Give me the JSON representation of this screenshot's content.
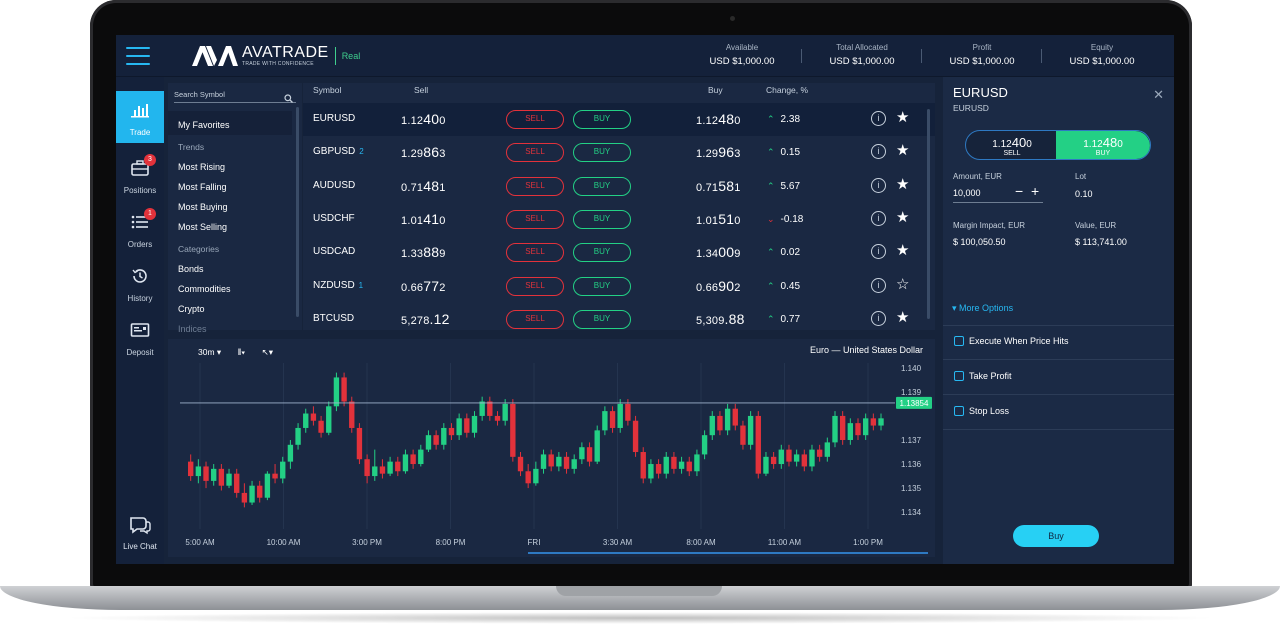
{
  "brand": {
    "name": "AVATRADE",
    "tagline": "TRADE WITH CONFIDENCE",
    "account_type": "Real"
  },
  "header_stats": [
    {
      "label": "Available",
      "value": "USD $1,000.00"
    },
    {
      "label": "Total Allocated",
      "value": "USD $1,000.00"
    },
    {
      "label": "Profit",
      "value": "USD $1,000.00"
    },
    {
      "label": "Equity",
      "value": "USD $1,000.00"
    }
  ],
  "nav": {
    "items": [
      {
        "label": "Trade",
        "icon": "bar-chart-icon",
        "active": true
      },
      {
        "label": "Positions",
        "icon": "briefcase-icon",
        "badge": "3"
      },
      {
        "label": "Orders",
        "icon": "list-icon",
        "badge": "1"
      },
      {
        "label": "History",
        "icon": "history-icon"
      },
      {
        "label": "Deposit",
        "icon": "deposit-icon"
      }
    ],
    "live_chat": "Live Chat"
  },
  "symbols_panel": {
    "search_placeholder": "Search Symbol",
    "favorites": "My Favorites",
    "trends_header": "Trends",
    "trends": [
      "Most Rising",
      "Most Falling",
      "Most Buying",
      "Most Selling"
    ],
    "categories_header": "Categories",
    "categories": [
      "Bonds",
      "Commodities",
      "Crypto",
      "Indices"
    ]
  },
  "quotes": {
    "headers": {
      "symbol": "Symbol",
      "sell": "Sell",
      "buy": "Buy",
      "change": "Change, %"
    },
    "sell_label": "SELL",
    "buy_label": "BUY",
    "rows": [
      {
        "symbol": "EURUSD",
        "count": "",
        "sell_a": "1.12",
        "sell_b": "40",
        "sell_c": "0",
        "buy_a": "1.12",
        "buy_b": "48",
        "buy_c": "0",
        "change": "2.38",
        "dir": "up",
        "fav": true
      },
      {
        "symbol": "GBPUSD",
        "count": "2",
        "sell_a": "1.29",
        "sell_b": "86",
        "sell_c": "3",
        "buy_a": "1.29",
        "buy_b": "96",
        "buy_c": "3",
        "change": "0.15",
        "dir": "up",
        "fav": true
      },
      {
        "symbol": "AUDUSD",
        "count": "",
        "sell_a": "0.71",
        "sell_b": "48",
        "sell_c": "1",
        "buy_a": "0.71",
        "buy_b": "58",
        "buy_c": "1",
        "change": "5.67",
        "dir": "up",
        "fav": true
      },
      {
        "symbol": "USDCHF",
        "count": "",
        "sell_a": "1.01",
        "sell_b": "41",
        "sell_c": "0",
        "buy_a": "1.01",
        "buy_b": "51",
        "buy_c": "0",
        "change": "-0.18",
        "dir": "down",
        "fav": true
      },
      {
        "symbol": "USDCAD",
        "count": "",
        "sell_a": "1.33",
        "sell_b": "88",
        "sell_c": "9",
        "buy_a": "1.34",
        "buy_b": "00",
        "buy_c": "9",
        "change": "0.02",
        "dir": "up",
        "fav": true
      },
      {
        "symbol": "NZDUSD",
        "count": "1",
        "sell_a": "0.66",
        "sell_b": "77",
        "sell_c": "2",
        "buy_a": "0.66",
        "buy_b": "90",
        "buy_c": "2",
        "change": "0.45",
        "dir": "up",
        "fav": false
      },
      {
        "symbol": "BTCUSD",
        "count": "",
        "sell_a": "5,278",
        "sell_b": ".12",
        "sell_c": "",
        "buy_a": "5,309",
        "buy_b": ".88",
        "buy_c": "",
        "change": "0.77",
        "dir": "up",
        "fav": true
      }
    ]
  },
  "chart": {
    "timeframe": "30m",
    "title": "Euro — United States Dollar",
    "y_ticks": [
      "1.140",
      "1.139",
      "1.137",
      "1.136",
      "1.135",
      "1.134"
    ],
    "current_price": "1.13854",
    "x_ticks": [
      "5:00 AM",
      "10:00 AM",
      "3:00 PM",
      "8:00 PM",
      "FRI",
      "3:30 AM",
      "8:00 AM",
      "11:00 AM",
      "1:00 PM"
    ]
  },
  "chart_data": {
    "type": "candlestick",
    "title": "Euro — United States Dollar",
    "interval": "30m",
    "ylim": [
      1.1333,
      1.1402
    ],
    "current_price": 1.13854,
    "x_ticks": [
      "5:00 AM",
      "10:00 AM",
      "3:00 PM",
      "8:00 PM",
      "FRI",
      "3:30 AM",
      "8:00 AM",
      "11:00 AM",
      "1:00 PM"
    ],
    "y_ticks": [
      1.14,
      1.139,
      1.137,
      1.136,
      1.135,
      1.134
    ],
    "candles": [
      [
        1.1361,
        1.1355,
        1.1364,
        1.1353
      ],
      [
        1.1355,
        1.1359,
        1.1362,
        1.1352
      ],
      [
        1.1359,
        1.1353,
        1.1361,
        1.135
      ],
      [
        1.1353,
        1.1358,
        1.136,
        1.1351
      ],
      [
        1.1358,
        1.1351,
        1.136,
        1.1349
      ],
      [
        1.1351,
        1.1356,
        1.1358,
        1.135
      ],
      [
        1.1356,
        1.1348,
        1.1358,
        1.1346
      ],
      [
        1.1348,
        1.1344,
        1.1352,
        1.1342
      ],
      [
        1.1344,
        1.1351,
        1.1353,
        1.1343
      ],
      [
        1.1351,
        1.1346,
        1.1353,
        1.1344
      ],
      [
        1.1346,
        1.1356,
        1.1357,
        1.1345
      ],
      [
        1.1356,
        1.1354,
        1.136,
        1.1352
      ],
      [
        1.1354,
        1.1361,
        1.1363,
        1.1352
      ],
      [
        1.1361,
        1.1368,
        1.137,
        1.1358
      ],
      [
        1.1368,
        1.1375,
        1.1377,
        1.1366
      ],
      [
        1.1375,
        1.1381,
        1.1383,
        1.1373
      ],
      [
        1.1381,
        1.1378,
        1.1384,
        1.1376
      ],
      [
        1.1378,
        1.1373,
        1.138,
        1.1371
      ],
      [
        1.1373,
        1.1384,
        1.1386,
        1.1372
      ],
      [
        1.1384,
        1.1396,
        1.1398,
        1.1382
      ],
      [
        1.1396,
        1.1386,
        1.1398,
        1.1384
      ],
      [
        1.1386,
        1.1375,
        1.1388,
        1.1373
      ],
      [
        1.1375,
        1.1362,
        1.1377,
        1.136
      ],
      [
        1.1362,
        1.1355,
        1.1364,
        1.1352
      ],
      [
        1.1355,
        1.1359,
        1.1366,
        1.1353
      ],
      [
        1.1359,
        1.1356,
        1.1362,
        1.1354
      ],
      [
        1.1356,
        1.1361,
        1.1363,
        1.1355
      ],
      [
        1.1361,
        1.1357,
        1.1363,
        1.1355
      ],
      [
        1.1357,
        1.1364,
        1.1366,
        1.1356
      ],
      [
        1.1364,
        1.136,
        1.1366,
        1.1358
      ],
      [
        1.136,
        1.1366,
        1.1368,
        1.1359
      ],
      [
        1.1366,
        1.1372,
        1.1374,
        1.1365
      ],
      [
        1.1372,
        1.1368,
        1.1374,
        1.1366
      ],
      [
        1.1368,
        1.1375,
        1.1377,
        1.1366
      ],
      [
        1.1375,
        1.1372,
        1.1377,
        1.137
      ],
      [
        1.1372,
        1.1379,
        1.1381,
        1.137
      ],
      [
        1.1379,
        1.1373,
        1.1381,
        1.1371
      ],
      [
        1.1373,
        1.138,
        1.1382,
        1.1371
      ],
      [
        1.138,
        1.1386,
        1.1388,
        1.1378
      ],
      [
        1.1386,
        1.138,
        1.1388,
        1.1378
      ],
      [
        1.138,
        1.1378,
        1.1382,
        1.1376
      ],
      [
        1.1378,
        1.1385,
        1.1387,
        1.1376
      ],
      [
        1.1385,
        1.1363,
        1.1387,
        1.1361
      ],
      [
        1.1363,
        1.1357,
        1.1365,
        1.1355
      ],
      [
        1.1357,
        1.1352,
        1.136,
        1.135
      ],
      [
        1.1352,
        1.1358,
        1.1361,
        1.1351
      ],
      [
        1.1358,
        1.1364,
        1.1366,
        1.1356
      ],
      [
        1.1364,
        1.1359,
        1.1366,
        1.1357
      ],
      [
        1.1359,
        1.1363,
        1.1365,
        1.1357
      ],
      [
        1.1363,
        1.1358,
        1.1365,
        1.1356
      ],
      [
        1.1358,
        1.1362,
        1.1364,
        1.1356
      ],
      [
        1.1362,
        1.1367,
        1.1369,
        1.136
      ],
      [
        1.1367,
        1.1361,
        1.1369,
        1.1359
      ],
      [
        1.1361,
        1.1374,
        1.1376,
        1.136
      ],
      [
        1.1374,
        1.1382,
        1.1384,
        1.1372
      ],
      [
        1.1382,
        1.1375,
        1.1384,
        1.1373
      ],
      [
        1.1375,
        1.1385,
        1.1387,
        1.1373
      ],
      [
        1.1385,
        1.1378,
        1.1387,
        1.1376
      ],
      [
        1.1378,
        1.1365,
        1.138,
        1.1363
      ],
      [
        1.1365,
        1.1354,
        1.1367,
        1.1352
      ],
      [
        1.1354,
        1.136,
        1.1362,
        1.1352
      ],
      [
        1.136,
        1.1356,
        1.1362,
        1.1354
      ],
      [
        1.1356,
        1.1363,
        1.1365,
        1.1354
      ],
      [
        1.1363,
        1.1358,
        1.1365,
        1.1356
      ],
      [
        1.1358,
        1.1361,
        1.1363,
        1.1356
      ],
      [
        1.1361,
        1.1357,
        1.1363,
        1.1355
      ],
      [
        1.1357,
        1.1364,
        1.1366,
        1.1355
      ],
      [
        1.1364,
        1.1372,
        1.1374,
        1.1362
      ],
      [
        1.1372,
        1.138,
        1.1382,
        1.137
      ],
      [
        1.138,
        1.1374,
        1.1382,
        1.1372
      ],
      [
        1.1374,
        1.1383,
        1.1385,
        1.1372
      ],
      [
        1.1383,
        1.1376,
        1.1385,
        1.1374
      ],
      [
        1.1376,
        1.1368,
        1.1378,
        1.1366
      ],
      [
        1.1368,
        1.138,
        1.1382,
        1.1366
      ],
      [
        1.138,
        1.1356,
        1.1382,
        1.1354
      ],
      [
        1.1356,
        1.1363,
        1.1365,
        1.1355
      ],
      [
        1.1363,
        1.136,
        1.1365,
        1.1358
      ],
      [
        1.136,
        1.1366,
        1.1368,
        1.1358
      ],
      [
        1.1366,
        1.1361,
        1.1368,
        1.1359
      ],
      [
        1.1361,
        1.1364,
        1.1366,
        1.1359
      ],
      [
        1.1364,
        1.1359,
        1.1366,
        1.1357
      ],
      [
        1.1359,
        1.1366,
        1.1368,
        1.1357
      ],
      [
        1.1366,
        1.1363,
        1.1368,
        1.1361
      ],
      [
        1.1363,
        1.1369,
        1.1371,
        1.1361
      ],
      [
        1.1369,
        1.138,
        1.1382,
        1.1367
      ],
      [
        1.138,
        1.137,
        1.1382,
        1.1368
      ],
      [
        1.137,
        1.1377,
        1.1379,
        1.1368
      ],
      [
        1.1377,
        1.1372,
        1.1379,
        1.137
      ],
      [
        1.1372,
        1.1379,
        1.1381,
        1.137
      ],
      [
        1.1379,
        1.1376,
        1.1381,
        1.1374
      ],
      [
        1.1376,
        1.1379,
        1.1381,
        1.1374
      ]
    ]
  },
  "order_panel": {
    "symbol": "EURUSD",
    "symbol_sub": "EURUSD",
    "sell_price_a": "1.12",
    "sell_price_b": "40",
    "sell_price_c": "0",
    "sell_label": "SELL",
    "buy_price_a": "1.12",
    "buy_price_b": "48",
    "buy_price_c": "0",
    "buy_label": "BUY",
    "amount_label": "Amount, EUR",
    "amount_value": "10,000",
    "lot_label": "Lot",
    "lot_value": "0.10",
    "margin_label": "Margin Impact, EUR",
    "margin_value": "$ 100,050.50",
    "value_label": "Value, EUR",
    "value_value": "$ 113,741.00",
    "more_options": "More Options",
    "checks": [
      "Execute When Price Hits",
      "Take Profit",
      "Stop Loss"
    ],
    "submit": "Buy"
  },
  "colors": {
    "accent": "#27b8f2",
    "buy": "#23d085",
    "sell": "#e2323b",
    "panel": "#1a2842",
    "bg": "#16233a"
  }
}
